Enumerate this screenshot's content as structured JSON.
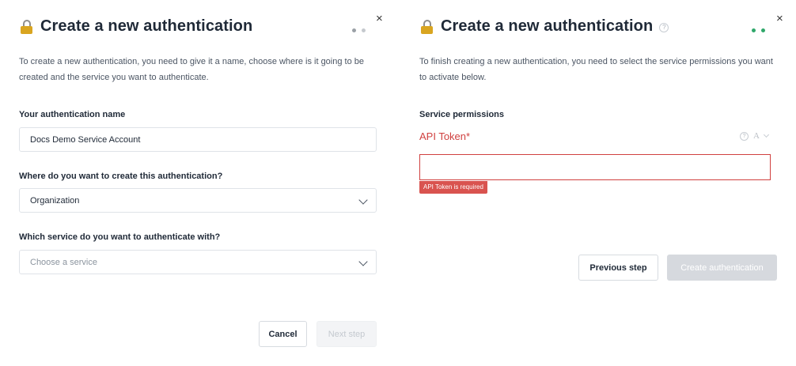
{
  "left": {
    "title": "Create a new authentication",
    "description": "To create a new authentication, you need to give it a name, choose where is it going to be created and the service you want to authenticate.",
    "name_label": "Your authentication name",
    "name_value": "Docs Demo Service Account",
    "location_label": "Where do you want to create this authentication?",
    "location_value": "Organization",
    "service_label": "Which service do you want to authenticate with?",
    "service_placeholder": "Choose a service",
    "cancel_label": "Cancel",
    "next_label": "Next step",
    "close_glyph": "×"
  },
  "right": {
    "title": "Create a new authentication",
    "help_glyph": "?",
    "description": "To finish creating a new authentication, you need to select the service permissions you want to activate below.",
    "section_label": "Service permissions",
    "api_token_label": "API Token*",
    "font_toggle": "A",
    "error_text": "API Token is required",
    "previous_label": "Previous step",
    "create_label": "Create authentication",
    "close_glyph": "×"
  },
  "colors": {
    "error": "#d0403f",
    "step_active_left": "#9aa0a6",
    "step_active_right": "#2fa76a",
    "lock_body": "#d9a520"
  },
  "icons": [
    "lock-icon",
    "close-icon",
    "help-icon",
    "chevron-down-icon"
  ]
}
